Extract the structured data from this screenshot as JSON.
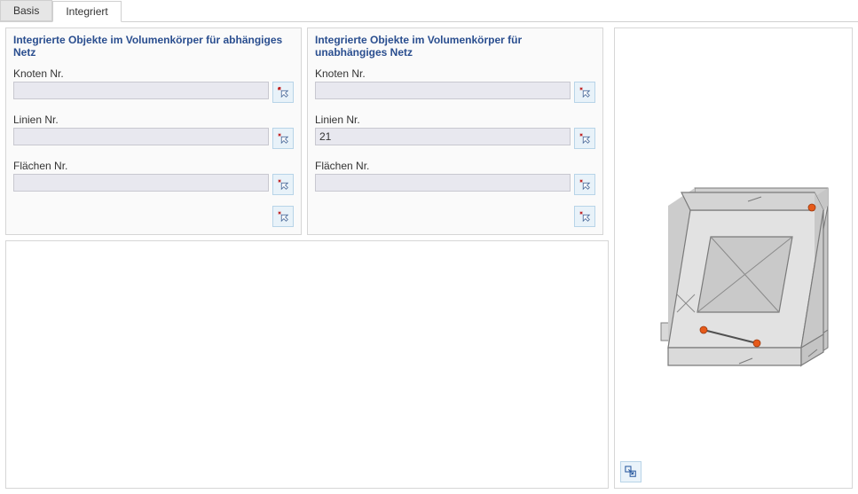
{
  "tabs": {
    "basis": "Basis",
    "integriert": "Integriert",
    "active": "integriert"
  },
  "panel_dependent": {
    "title": "Integrierte Objekte im Volumenkörper für abhängiges Netz",
    "knoten_label": "Knoten Nr.",
    "knoten_value": "",
    "linien_label": "Linien Nr.",
    "linien_value": "",
    "flaechen_label": "Flächen Nr.",
    "flaechen_value": ""
  },
  "panel_independent": {
    "title": "Integrierte Objekte im Volumenkörper für unabhängiges Netz",
    "knoten_label": "Knoten Nr.",
    "knoten_value": "",
    "linien_label": "Linien Nr.",
    "linien_value": "21",
    "flaechen_label": "Flächen Nr.",
    "flaechen_value": ""
  },
  "icons": {
    "pick": "pick-cursor-x-icon",
    "pick_multi": "pick-multi-icon",
    "preview_expand": "expand-preview-icon"
  }
}
